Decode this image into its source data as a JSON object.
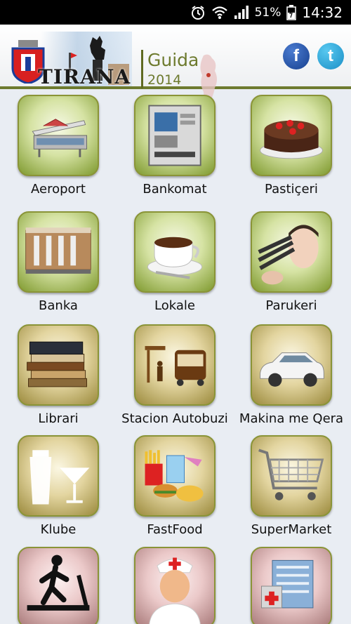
{
  "status_bar": {
    "battery_percent": "51%",
    "time": "14:32",
    "icons": [
      "alarm-icon",
      "wifi-icon",
      "signal-icon",
      "battery-icon"
    ]
  },
  "header": {
    "city_name": "TIRANA",
    "title": "Guida",
    "year": "2014",
    "facebook_glyph": "f",
    "twitter_glyph": "t"
  },
  "categories": [
    {
      "label": "Aeroport",
      "icon": "airport-icon",
      "theme": "green"
    },
    {
      "label": "Bankomat",
      "icon": "atm-icon",
      "theme": "green"
    },
    {
      "label": "Pastiçeri",
      "icon": "cake-icon",
      "theme": "green"
    },
    {
      "label": "Banka",
      "icon": "bank-icon",
      "theme": "green"
    },
    {
      "label": "Lokale",
      "icon": "coffee-cup-icon",
      "theme": "green"
    },
    {
      "label": "Parukeri",
      "icon": "makeup-brushes-icon",
      "theme": "green"
    },
    {
      "label": "Librari",
      "icon": "books-icon",
      "theme": "gold"
    },
    {
      "label": "Stacion Autobuzi",
      "icon": "bus-stop-icon",
      "theme": "gold"
    },
    {
      "label": "Makina me Qera",
      "icon": "rental-car-icon",
      "theme": "gold"
    },
    {
      "label": "Klube",
      "icon": "cocktail-icon",
      "theme": "gold"
    },
    {
      "label": "FastFood",
      "icon": "fastfood-icon",
      "theme": "gold"
    },
    {
      "label": "SuperMarket",
      "icon": "shopping-cart-icon",
      "theme": "gold"
    },
    {
      "label": "",
      "icon": "treadmill-icon",
      "theme": "pink"
    },
    {
      "label": "",
      "icon": "doctor-icon",
      "theme": "pink"
    },
    {
      "label": "",
      "icon": "hospital-icon",
      "theme": "pink"
    }
  ]
}
